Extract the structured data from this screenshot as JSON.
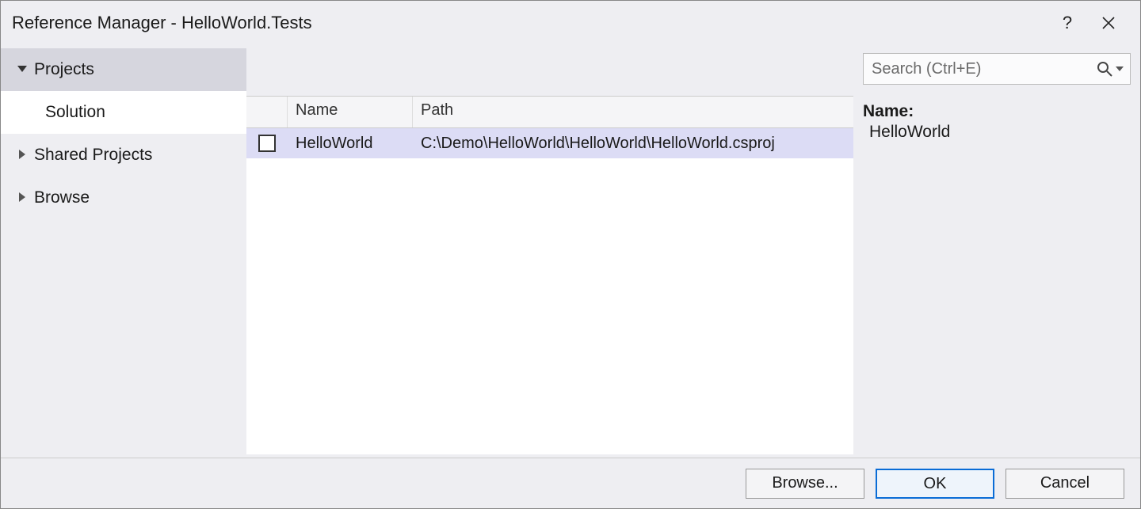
{
  "title": "Reference Manager - HelloWorld.Tests",
  "sidebar": {
    "items": [
      {
        "label": "Projects",
        "kind": "group-expanded"
      },
      {
        "label": "Solution",
        "kind": "child"
      },
      {
        "label": "Shared Projects",
        "kind": "group-collapsed"
      },
      {
        "label": "Browse",
        "kind": "group-collapsed"
      }
    ]
  },
  "table": {
    "columns": {
      "name": "Name",
      "path": "Path"
    },
    "rows": [
      {
        "name": "HelloWorld",
        "path": "C:\\Demo\\HelloWorld\\HelloWorld\\HelloWorld.csproj",
        "checked": false,
        "selected": true
      }
    ]
  },
  "search": {
    "placeholder": "Search (Ctrl+E)"
  },
  "details": {
    "name_label": "Name:",
    "name_value": "HelloWorld"
  },
  "footer": {
    "browse": "Browse...",
    "ok": "OK",
    "cancel": "Cancel"
  }
}
